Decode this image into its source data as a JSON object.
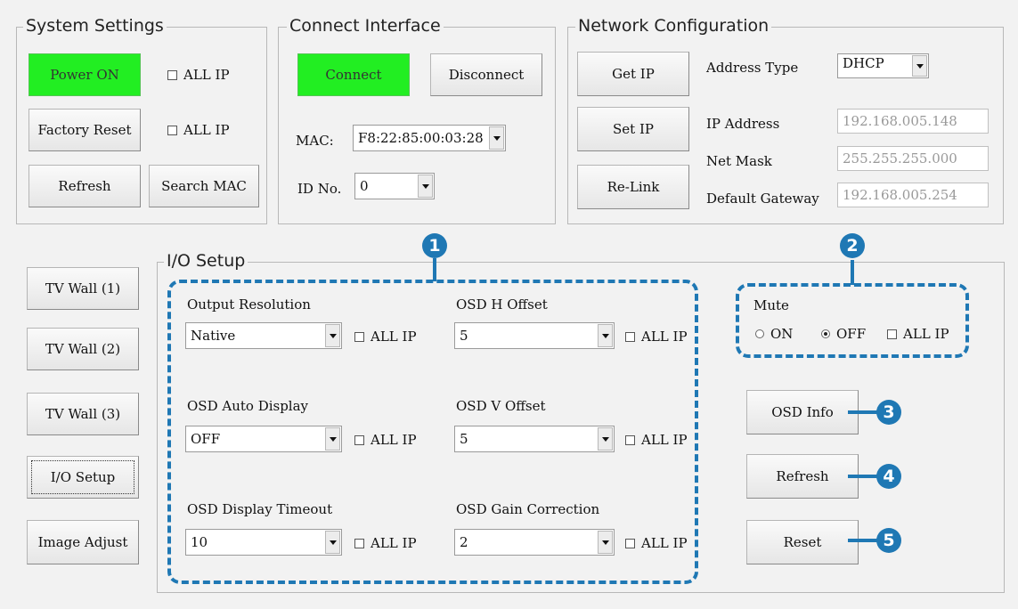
{
  "system_settings": {
    "title": "System Settings",
    "power_on_label": "Power ON",
    "factory_reset_label": "Factory Reset",
    "refresh_label": "Refresh",
    "search_mac_label": "Search MAC",
    "all_ip_1": "ALL IP",
    "all_ip_2": "ALL IP"
  },
  "connect_interface": {
    "title": "Connect Interface",
    "connect_label": "Connect",
    "disconnect_label": "Disconnect",
    "mac_label": "MAC:",
    "mac_value": "F8:22:85:00:03:28",
    "id_label": "ID No.",
    "id_value": "0"
  },
  "network": {
    "title": "Network Configuration",
    "get_ip_label": "Get IP",
    "set_ip_label": "Set IP",
    "relink_label": "Re-Link",
    "address_type_label": "Address Type",
    "address_type_value": "DHCP",
    "ip_address_label": "IP Address",
    "ip_address_value": "192.168.005.148",
    "net_mask_label": "Net Mask",
    "net_mask_value": "255.255.255.000",
    "gateway_label": "Default Gateway",
    "gateway_value": "192.168.005.254"
  },
  "nav": {
    "tv_wall_1": "TV Wall (1)",
    "tv_wall_2": "TV Wall (2)",
    "tv_wall_3": "TV Wall (3)",
    "io_setup": "I/O Setup",
    "image_adjust": "Image Adjust"
  },
  "io_setup": {
    "title": "I/O Setup",
    "all_ip": "ALL IP",
    "output_resolution": {
      "label": "Output Resolution",
      "value": "Native"
    },
    "osd_auto_display": {
      "label": "OSD Auto Display",
      "value": "OFF"
    },
    "osd_display_timeout": {
      "label": "OSD Display Timeout",
      "value": "10"
    },
    "osd_h_offset": {
      "label": "OSD H Offset",
      "value": "5"
    },
    "osd_v_offset": {
      "label": "OSD V Offset",
      "value": "5"
    },
    "osd_gain_correction": {
      "label": "OSD Gain Correction",
      "value": "2"
    },
    "mute": {
      "label": "Mute",
      "on_label": "ON",
      "off_label": "OFF",
      "selected": "OFF",
      "all_ip": "ALL IP"
    },
    "osd_info_label": "OSD Info",
    "refresh_label": "Refresh",
    "reset_label": "Reset"
  },
  "callouts": [
    "1",
    "2",
    "3",
    "4",
    "5"
  ],
  "colors": {
    "active_green": "#22ee22",
    "callout_blue": "#1f78b4"
  }
}
